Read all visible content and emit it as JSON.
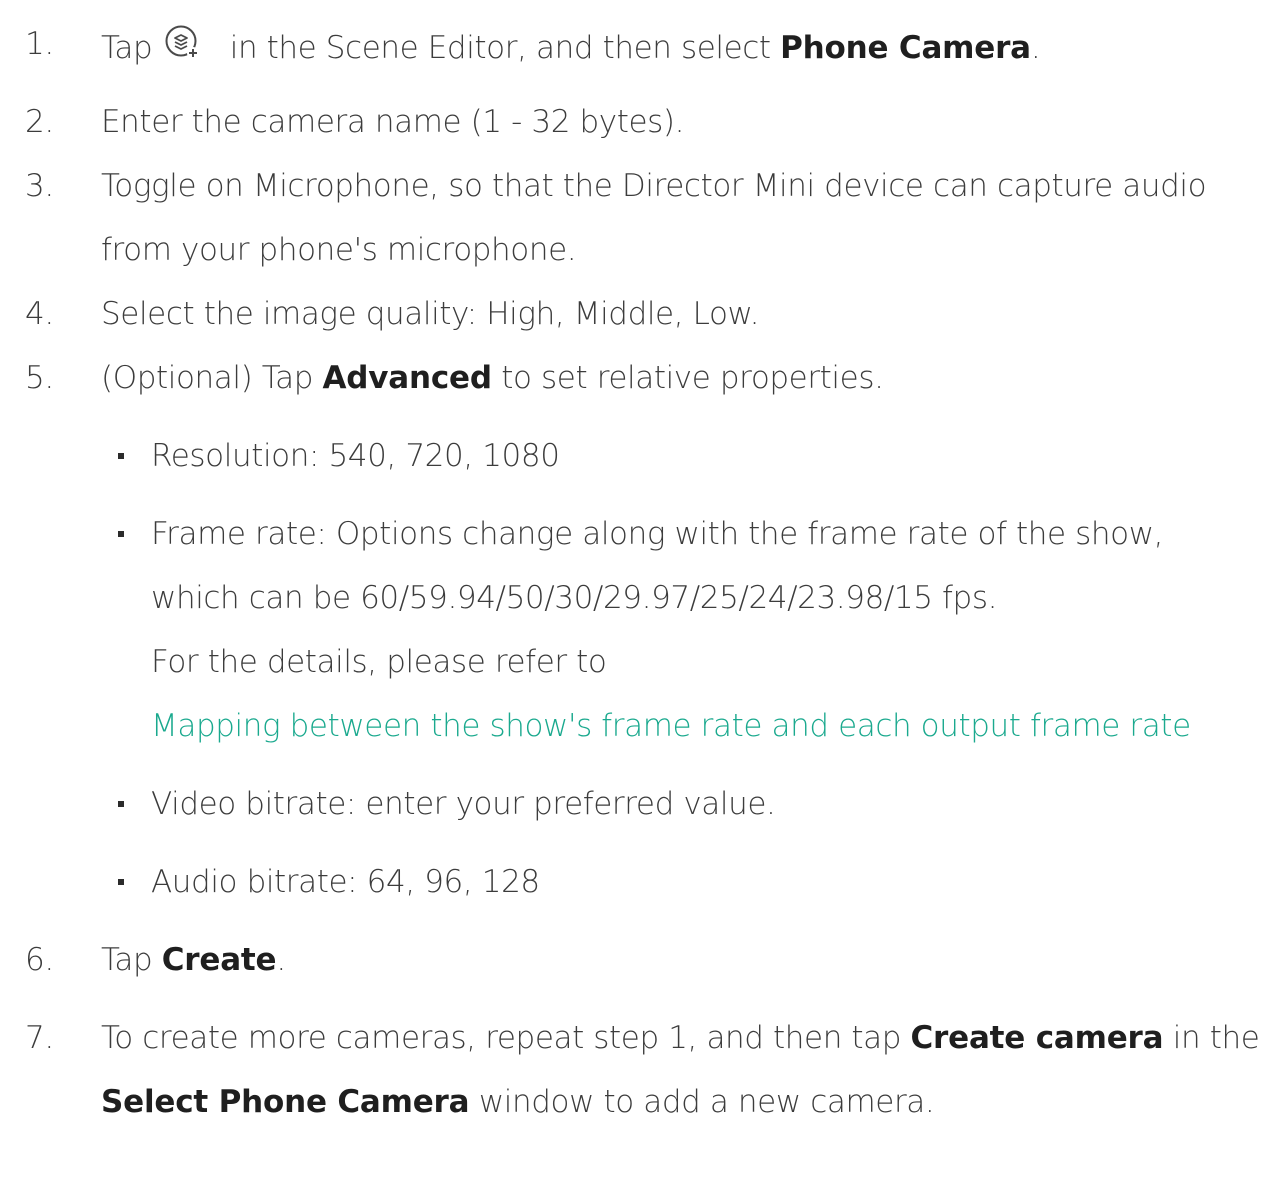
{
  "steps": [
    {
      "number": "1.",
      "pre": "Tap",
      "mid": " in the Scene Editor, and then select ",
      "bold": "Phone Camera",
      "post": ".",
      "icon": "add-scene-layer-icon"
    },
    {
      "number": "2.",
      "text": "Enter the camera name (1 - 32 bytes)."
    },
    {
      "number": "3.",
      "line1": "Toggle on Microphone, so that the Director Mini device can capture audio",
      "line2": "from your phone's microphone."
    },
    {
      "number": "4.",
      "text": "Select the image quality: High, Middle, Low."
    },
    {
      "number": "5.",
      "pre": "(Optional) Tap ",
      "bold": "Advanced",
      "post": " to set relative properties."
    },
    {
      "number": "6.",
      "pre": "Tap ",
      "bold": "Create",
      "post": "."
    },
    {
      "number": "7.",
      "pre": "To create more cameras, repeat step 1, and then tap ",
      "bold": "Create camera",
      "post": " in the",
      "bold2": "Select Phone Camera",
      "post2": " window to add a new camera."
    }
  ],
  "advanced": {
    "resolution": "Resolution: 540, 720, 1080",
    "framerate_line1": "Frame rate: Options change along with the frame rate of the show,",
    "framerate_line2": "which can be 60/59.94/50/30/29.97/25/24/23.98/15 fps.",
    "framerate_line3": "For the details, please refer to",
    "framerate_link": "Mapping between the show's frame rate and each output frame rate",
    "video_bitrate": "Video bitrate: enter your preferred value.",
    "audio_bitrate": "Audio bitrate: 64, 96, 128"
  },
  "colors": {
    "text": "#3c3c3c",
    "link": "#1aa98e"
  }
}
